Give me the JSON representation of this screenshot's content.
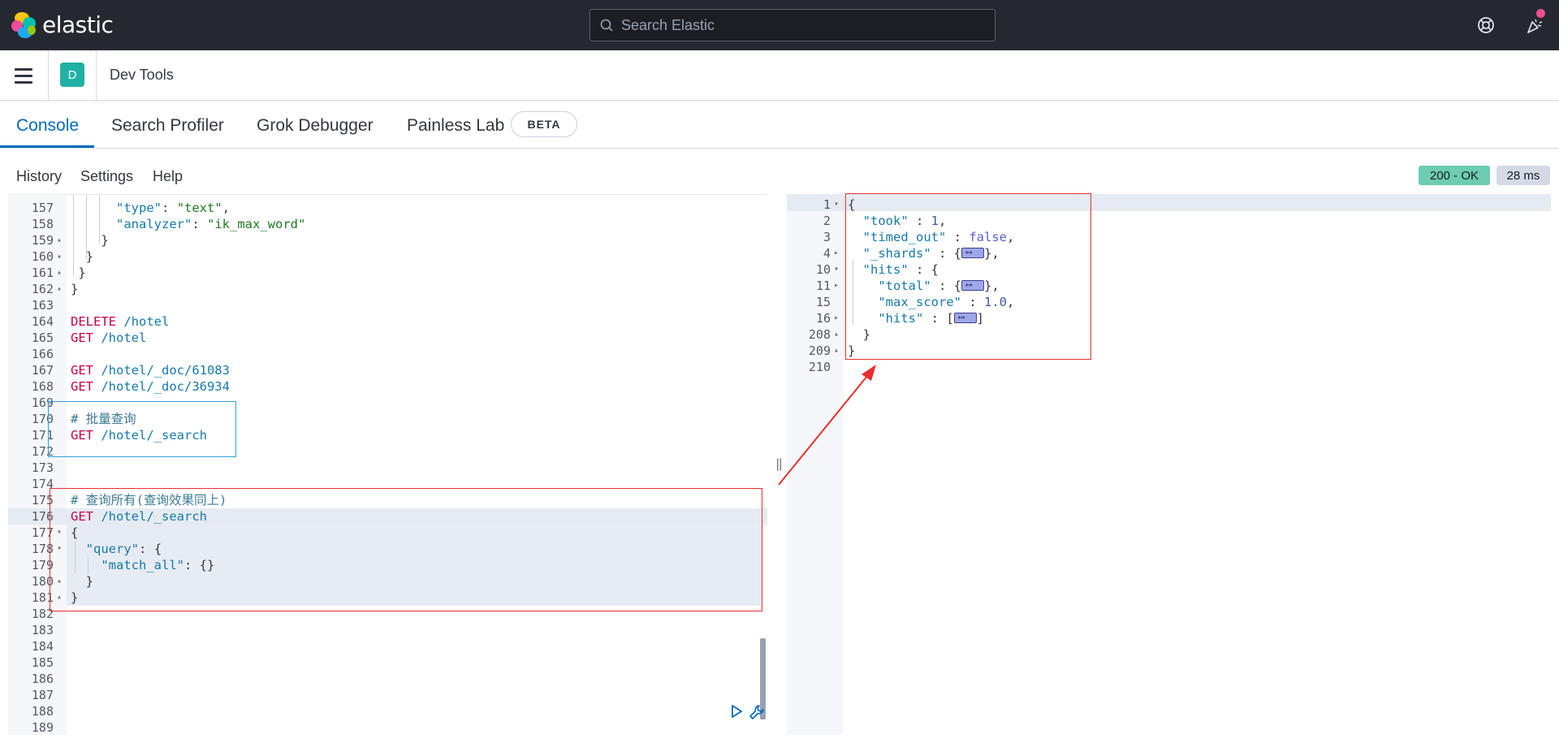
{
  "header": {
    "brand": "elastic",
    "search_placeholder": "Search Elastic"
  },
  "breadcrumb": {
    "avatar_letter": "D",
    "title": "Dev Tools"
  },
  "tabs": [
    {
      "label": "Console",
      "active": true
    },
    {
      "label": "Search Profiler"
    },
    {
      "label": "Grok Debugger"
    },
    {
      "label": "Painless Lab"
    }
  ],
  "beta_label": "BETA",
  "submenu": {
    "history": "History",
    "settings": "Settings",
    "help": "Help"
  },
  "status": {
    "code": "200 - OK",
    "time": "28 ms"
  },
  "editor": {
    "lines": [
      {
        "n": "157",
        "f": "",
        "t": "      \"type\": \"text\","
      },
      {
        "n": "158",
        "f": "",
        "t": "      \"analyzer\": \"ik_max_word\""
      },
      {
        "n": "159",
        "f": "▴",
        "t": "    }"
      },
      {
        "n": "160",
        "f": "▴",
        "t": "  }"
      },
      {
        "n": "161",
        "f": "▴",
        "t": " }"
      },
      {
        "n": "162",
        "f": "▴",
        "t": "}"
      },
      {
        "n": "163",
        "f": "",
        "t": ""
      },
      {
        "n": "164",
        "f": "",
        "t": "DELETE /hotel"
      },
      {
        "n": "165",
        "f": "",
        "t": "GET /hotel"
      },
      {
        "n": "166",
        "f": "",
        "t": ""
      },
      {
        "n": "167",
        "f": "",
        "t": "GET /hotel/_doc/61083"
      },
      {
        "n": "168",
        "f": "",
        "t": "GET /hotel/_doc/36934"
      },
      {
        "n": "169",
        "f": "",
        "t": ""
      },
      {
        "n": "170",
        "f": "",
        "t": "# 批量查询"
      },
      {
        "n": "171",
        "f": "",
        "t": "GET /hotel/_search"
      },
      {
        "n": "172",
        "f": "",
        "t": ""
      },
      {
        "n": "173",
        "f": "",
        "t": ""
      },
      {
        "n": "174",
        "f": "",
        "t": ""
      },
      {
        "n": "175",
        "f": "",
        "t": "# 查询所有(查询效果同上)"
      },
      {
        "n": "176",
        "f": "",
        "t": "GET /hotel/_search"
      },
      {
        "n": "177",
        "f": "▾",
        "t": "{"
      },
      {
        "n": "178",
        "f": "▾",
        "t": "  \"query\": {"
      },
      {
        "n": "179",
        "f": "",
        "t": "    \"match_all\": {}"
      },
      {
        "n": "180",
        "f": "▴",
        "t": "  }"
      },
      {
        "n": "181",
        "f": "▴",
        "t": "}"
      },
      {
        "n": "182",
        "f": "",
        "t": ""
      },
      {
        "n": "183",
        "f": "",
        "t": ""
      },
      {
        "n": "184",
        "f": "",
        "t": ""
      },
      {
        "n": "185",
        "f": "",
        "t": ""
      },
      {
        "n": "186",
        "f": "",
        "t": ""
      },
      {
        "n": "187",
        "f": "",
        "t": ""
      },
      {
        "n": "188",
        "f": "",
        "t": ""
      },
      {
        "n": "189",
        "f": "",
        "t": ""
      }
    ]
  },
  "output": {
    "lines": [
      {
        "n": "1",
        "f": "▾"
      },
      {
        "n": "2",
        "f": ""
      },
      {
        "n": "3",
        "f": ""
      },
      {
        "n": "4",
        "f": "▸"
      },
      {
        "n": "10",
        "f": "▾"
      },
      {
        "n": "11",
        "f": "▸"
      },
      {
        "n": "15",
        "f": ""
      },
      {
        "n": "16",
        "f": "▸"
      },
      {
        "n": "208",
        "f": "▴"
      },
      {
        "n": "209",
        "f": "▴"
      },
      {
        "n": "210",
        "f": ""
      }
    ],
    "took": "1",
    "timed_out": "false",
    "max_score": "1.0"
  }
}
